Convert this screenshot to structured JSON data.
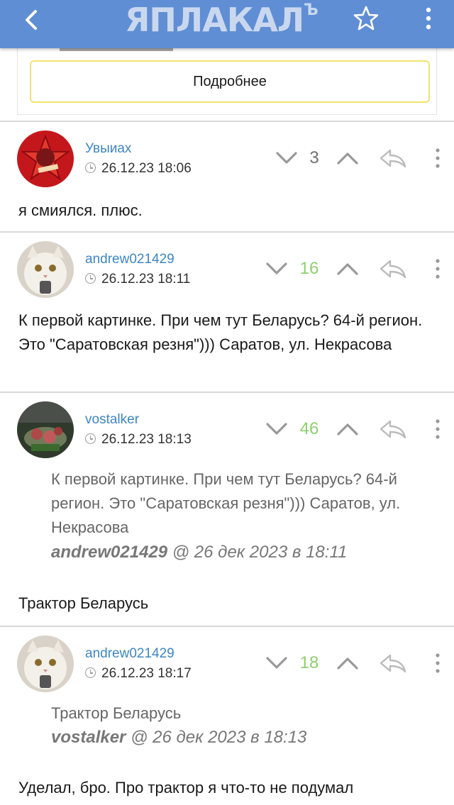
{
  "header": {
    "logo_text": "ЯПЛАКАЛ",
    "logo_suffix": "Ъ",
    "back_icon": "chevron-left-icon",
    "star_icon": "star-icon",
    "menu_icon": "kebab-menu-icon",
    "color": "#5f8ed4"
  },
  "previous_post": {
    "more_button_label": "Подробнее"
  },
  "comments": [
    {
      "author": "Увыиах",
      "time": "26.12.23 18:06",
      "score": "3",
      "text": "я смиялся. плюс."
    },
    {
      "author": "andrew021429",
      "time": "26.12.23 18:11",
      "score": "16",
      "text": "К первой картинке. При чем тут Беларусь? 64-й регион. Это \"Саратовская резня\"))) Саратов, ул. Некрасова"
    },
    {
      "author": "vostalker",
      "time": "26.12.23 18:13",
      "score": "46",
      "quote": {
        "text": "К первой картинке. При чем тут Беларусь? 64-й регион. Это \"Саратовская резня\"))) Саратов, ул. Некрасова",
        "author": "andrew021429",
        "suffix": " @ 26 дек 2023 в 18:11"
      },
      "text": "Трактор Беларусь"
    },
    {
      "author": "andrew021429",
      "time": "26.12.23 18:17",
      "score": "18",
      "quote": {
        "text": "Трактор Беларусь",
        "author": "vostalker",
        "suffix": " @ 26 дек 2023 в 18:13"
      },
      "text": "Уделал, бро. Про трактор я что-то не подумал"
    }
  ],
  "colors": {
    "author_link": "#3d86c6",
    "positive_score": "#8fcf6f",
    "neutral_score": "#707070",
    "more_button_border": "#f1e36c"
  }
}
